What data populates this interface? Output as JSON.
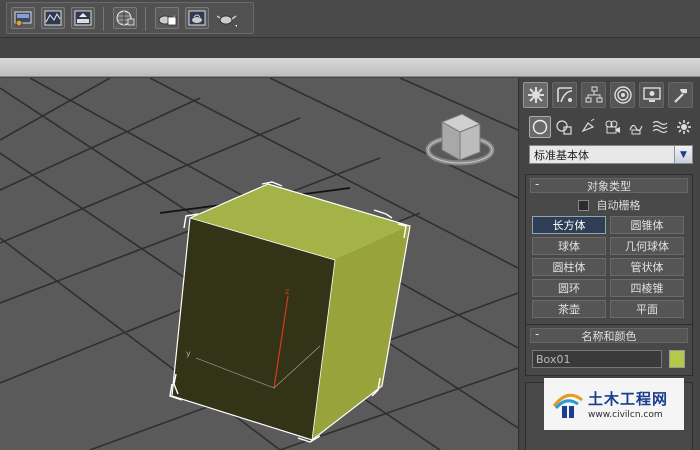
{
  "toolbar": {
    "buttons": [
      "render-setup-icon",
      "rendered-frame-window-icon",
      "render-production-icon",
      "material-editor-icon",
      "render-teapot-icon",
      "render-iterative-icon",
      "render-activeshade-icon"
    ]
  },
  "panel": {
    "tabs": [
      "create-icon",
      "modify-icon",
      "hierarchy-icon",
      "motion-icon",
      "display-icon",
      "utilities-icon"
    ],
    "categories": [
      "geometry-icon",
      "shapes-icon",
      "lights-icon",
      "cameras-icon",
      "helpers-icon",
      "space-warps-icon",
      "systems-icon"
    ],
    "dropdown_value": "标准基本体",
    "object_type": {
      "title": "对象类型",
      "autogrid_label": "自动栅格",
      "buttons": [
        {
          "label": "长方体",
          "active": true
        },
        {
          "label": "圆锥体"
        },
        {
          "label": "球体"
        },
        {
          "label": "几何球体"
        },
        {
          "label": "圆柱体"
        },
        {
          "label": "管状体"
        },
        {
          "label": "圆环"
        },
        {
          "label": "四棱锥"
        },
        {
          "label": "茶壶"
        },
        {
          "label": "平面"
        }
      ]
    },
    "name_color": {
      "title": "名称和颜色",
      "name_value": "Box01",
      "color": "#b4c84a"
    }
  },
  "viewport": {
    "gizmo_z_label": "z",
    "gizmo_y_label": "y"
  },
  "watermark": {
    "site_name": "土木工程网",
    "url": "www.civilcn.com"
  },
  "colors": {
    "box_top": "#a3b347",
    "box_front": "#333318",
    "box_side": "#98a33c",
    "selection": "#ffffff",
    "axis_z": "#d63a1a"
  }
}
